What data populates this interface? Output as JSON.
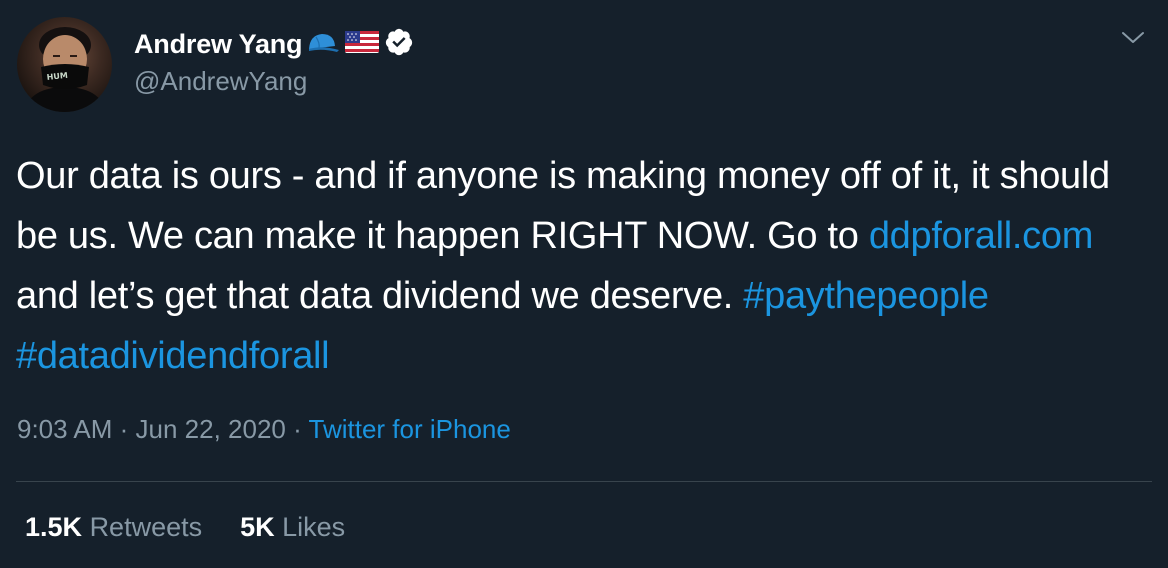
{
  "user": {
    "display_name": "Andrew Yang",
    "handle": "@AndrewYang",
    "verified": true,
    "emojis": [
      "cap-emoji",
      "us-flag-emoji"
    ],
    "avatar_mask_text": "HUMAN"
  },
  "tweet": {
    "text_parts": {
      "p1": "Our data is ours - and if anyone is making money off of it, it should be us. We can make it happen RIGHT NOW. Go to ",
      "link": "ddpforall.com",
      "p2": " and let’s get that data dividend we deserve. ",
      "hashtag1": "#paythepeople",
      "space": " ",
      "hashtag2": "#datadividendforall"
    }
  },
  "meta": {
    "time": "9:03 AM",
    "separator": " · ",
    "date": "Jun 22, 2020",
    "separator2": " · ",
    "source": "Twitter for iPhone"
  },
  "stats": {
    "retweets_count": "1.5K",
    "retweets_label": "Retweets",
    "likes_count": "5K",
    "likes_label": "Likes"
  },
  "colors": {
    "background": "#15202b",
    "link": "#1b95e0",
    "secondary_text": "#8899a6",
    "divider": "#38444d"
  }
}
